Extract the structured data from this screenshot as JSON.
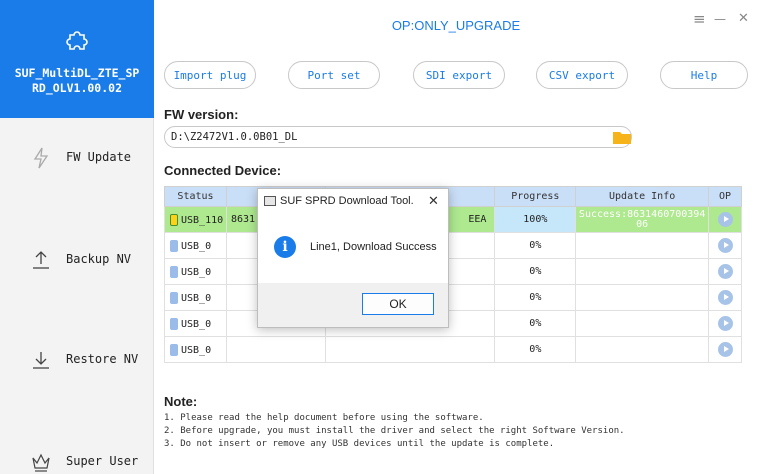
{
  "sidebar": {
    "app_name_line1": "SUF_MultiDL_ZTE_SP",
    "app_name_line2": "RD_OLV1.00.02",
    "items": [
      {
        "label": "FW Update",
        "icon": "lightning-icon"
      },
      {
        "label": "Backup NV",
        "icon": "upload-icon"
      },
      {
        "label": "Restore NV",
        "icon": "download-icon"
      },
      {
        "label": "Super User",
        "icon": "crown-icon"
      }
    ]
  },
  "titlebar": {
    "title": "OP:ONLY_UPGRADE",
    "menu_glyph": "≡",
    "minimize_glyph": "—",
    "close_glyph": "✕"
  },
  "toolbar": {
    "import_plug": "Import plug",
    "port_set": "Port set",
    "sdi_export": "SDI export",
    "csv_export": "CSV export",
    "help": "Help"
  },
  "fw": {
    "label": "FW version:",
    "path": "D:\\Z2472V1.0.0B01_DL"
  },
  "devices": {
    "label": "Connected Device:",
    "columns": [
      "Status",
      "",
      "",
      "Progress",
      "Update Info",
      "OP"
    ],
    "rows": [
      {
        "status": "USB_110",
        "c2": "8631",
        "c3": "EEA",
        "progress": "100%",
        "info": "Success:863146070039406"
      },
      {
        "status": "USB_0",
        "c2": "",
        "c3": "",
        "progress": "0%",
        "info": ""
      },
      {
        "status": "USB_0",
        "c2": "",
        "c3": "",
        "progress": "0%",
        "info": ""
      },
      {
        "status": "USB_0",
        "c2": "",
        "c3": "",
        "progress": "0%",
        "info": ""
      },
      {
        "status": "USB_0",
        "c2": "",
        "c3": "",
        "progress": "0%",
        "info": ""
      },
      {
        "status": "USB_0",
        "c2": "",
        "c3": "",
        "progress": "0%",
        "info": ""
      }
    ]
  },
  "notes": {
    "label": "Note:",
    "lines": [
      "1. Please read the help document before using the software.",
      "2. Before upgrade, you must install the driver and select the right Software Version.",
      "3. Do not insert or remove any USB devices until the update is complete."
    ]
  },
  "dialog": {
    "title": "SUF SPRD Download Tool.",
    "close_glyph": "✕",
    "message": "Line1, Download Success",
    "ok_label": "OK",
    "icon": "info-icon"
  },
  "colors": {
    "accent": "#1a7ce8",
    "success_row": "#aee88f",
    "header_bg": "#c9def7"
  }
}
